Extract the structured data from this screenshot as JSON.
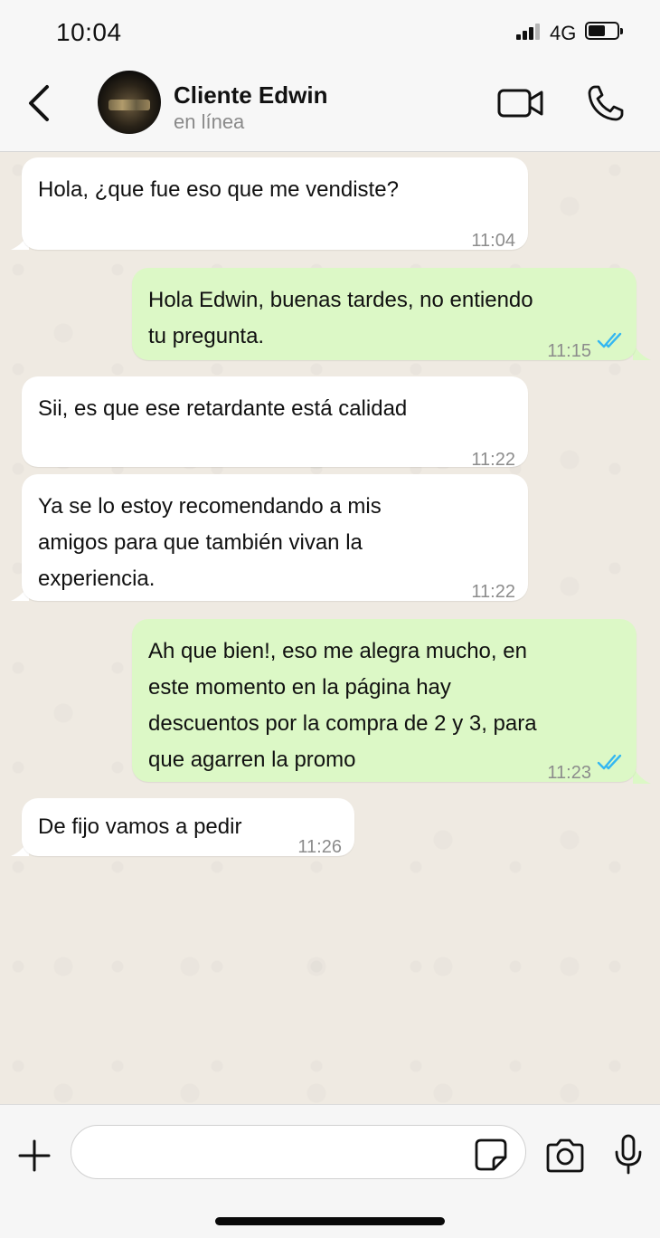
{
  "status_bar": {
    "time": "10:04",
    "network": "4G"
  },
  "header": {
    "contact_name": "Cliente Edwin",
    "contact_status": "en línea"
  },
  "messages": [
    {
      "direction": "in",
      "text": "Hola, ¿que fue eso que me vendiste?",
      "time": "11:04"
    },
    {
      "direction": "out",
      "text": "Hola Edwin, buenas tardes, no entiendo\ntu pregunta.",
      "time": "11:15",
      "read": true
    },
    {
      "direction": "in",
      "text": "Sii, es que ese retardante está calidad",
      "time": "11:22"
    },
    {
      "direction": "in",
      "text": "Ya se lo estoy recomendando a mis\namigos para que también vivan la\nexperiencia.",
      "time": "11:22"
    },
    {
      "direction": "out",
      "text": "Ah que bien!, eso me alegra mucho, en\neste momento en la página hay\ndescuentos por la compra de 2 y 3, para\nque agarren la promo",
      "time": "11:23",
      "read": true
    },
    {
      "direction": "in",
      "text": "De fijo vamos a pedir",
      "time": "11:26"
    }
  ],
  "input": {
    "value": "",
    "placeholder": ""
  },
  "colors": {
    "incoming_bubble": "#ffffff",
    "outgoing_bubble": "#dcf8c6",
    "read_ticks": "#34b7f1",
    "chat_background": "#efeae2"
  },
  "icons": [
    "back-icon",
    "video-call-icon",
    "phone-icon",
    "plus-icon",
    "sticker-icon",
    "camera-icon",
    "microphone-icon"
  ]
}
